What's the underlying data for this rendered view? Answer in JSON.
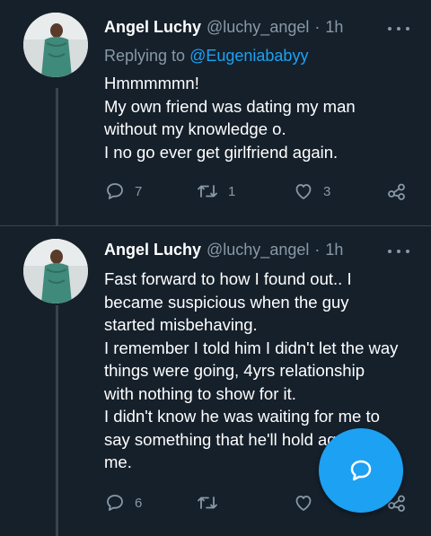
{
  "tweets": [
    {
      "name": "Angel Luchy",
      "handle": "@luchy_angel",
      "separator": "·",
      "time": "1h",
      "replying_label": "Replying to",
      "replying_to": "@Eugeniababyy",
      "lines": [
        "Hmmmmmn!",
        "My own friend was dating my man",
        "without my knowledge o.",
        "I no go ever get girlfriend again."
      ],
      "replies": "7",
      "retweets": "1",
      "likes": "3"
    },
    {
      "name": "Angel Luchy",
      "handle": "@luchy_angel",
      "separator": "·",
      "time": "1h",
      "lines": [
        "Fast forward to how I found out.. I",
        "became suspicious when the guy",
        "started misbehaving.",
        "I remember I told him I didn't let the way",
        "things were going, 4yrs relationship",
        "with nothing to show for it.",
        "I didn't know he was waiting for me to",
        "say something that he'll hold against",
        "me."
      ],
      "replies": "6"
    }
  ],
  "compose_fab": {
    "icon": "compose-reply-icon"
  },
  "colors": {
    "background": "#15202b",
    "accent": "#1da1f2",
    "muted": "#8899a6"
  }
}
